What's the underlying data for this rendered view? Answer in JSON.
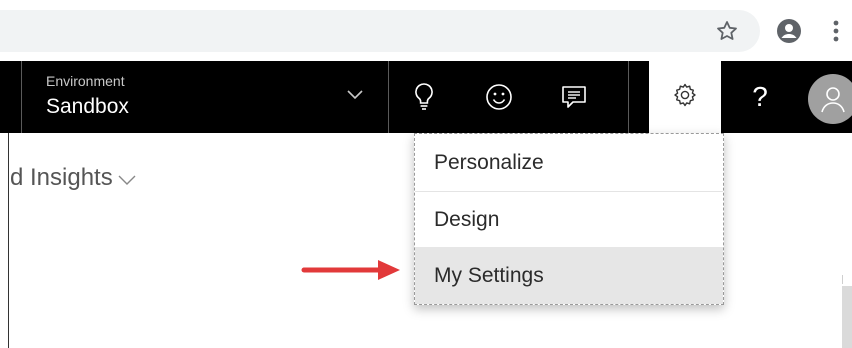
{
  "app_header": {
    "environment_label": "Environment",
    "environment_value": "Sandbox",
    "help_glyph": "?"
  },
  "content": {
    "title_fragment": "d Insights"
  },
  "settings_menu": {
    "items": [
      {
        "label": "Personalize"
      },
      {
        "label": "Design"
      },
      {
        "label": "My Settings"
      }
    ],
    "highlighted_item": "My Settings"
  },
  "icons": {
    "chrome": [
      "star-icon",
      "account-circle-icon",
      "more-vert-icon"
    ],
    "header": [
      "chevron-down-icon",
      "lightbulb-icon",
      "smiley-icon",
      "feedback-icon",
      "gear-icon",
      "help-icon",
      "user-avatar-icon"
    ]
  },
  "colors": {
    "header_bg": "#000000",
    "menu_highlight": "#e6e6e6",
    "annotation_arrow": "#e2393a"
  }
}
